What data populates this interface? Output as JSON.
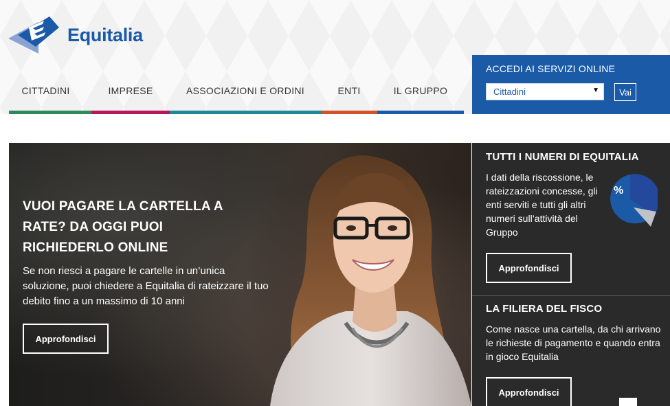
{
  "brand": {
    "name": "Equitalia",
    "color": "#1b5aa7"
  },
  "nav": {
    "items": [
      {
        "label": "CITTADINI",
        "color": "#2e8b57"
      },
      {
        "label": "IMPRESE",
        "color": "#b5195b"
      },
      {
        "label": "ASSOCIAZIONI E ORDINI",
        "color": "#1e8a99"
      },
      {
        "label": "ENTI",
        "color": "#d2532a"
      },
      {
        "label": "IL GRUPPO",
        "color": "#1b5aa7"
      }
    ]
  },
  "access": {
    "title": "ACCEDI AI SERVIZI ONLINE",
    "selected": "Cittadini",
    "button": "Vai"
  },
  "hero": {
    "title": "VUOI PAGARE LA CARTELLA A RATE? DA OGGI PUOI RICHIEDERLO ONLINE",
    "text": "Se non riesci a pagare le cartelle in un’unica soluzione, puoi chiedere a Equitalia di rateizzare il tuo debito fino a un massimo di 10 anni",
    "button": "Approfondisci"
  },
  "panels": [
    {
      "title": "TUTTI I NUMERI DI EQUITALIA",
      "text": "I dati della riscossione, le rateizzazioni concesse, gli enti serviti e tutti gli altri numeri sull’attività del Gruppo",
      "button": "Approfondisci",
      "icon_label": "%"
    },
    {
      "title": "LA FILIERA DEL FISCO",
      "text": "Come nasce una cartella, da chi arrivano le richieste di pagamento e quando entra in gioco Equitalia",
      "button": "Approfondisci"
    }
  ]
}
